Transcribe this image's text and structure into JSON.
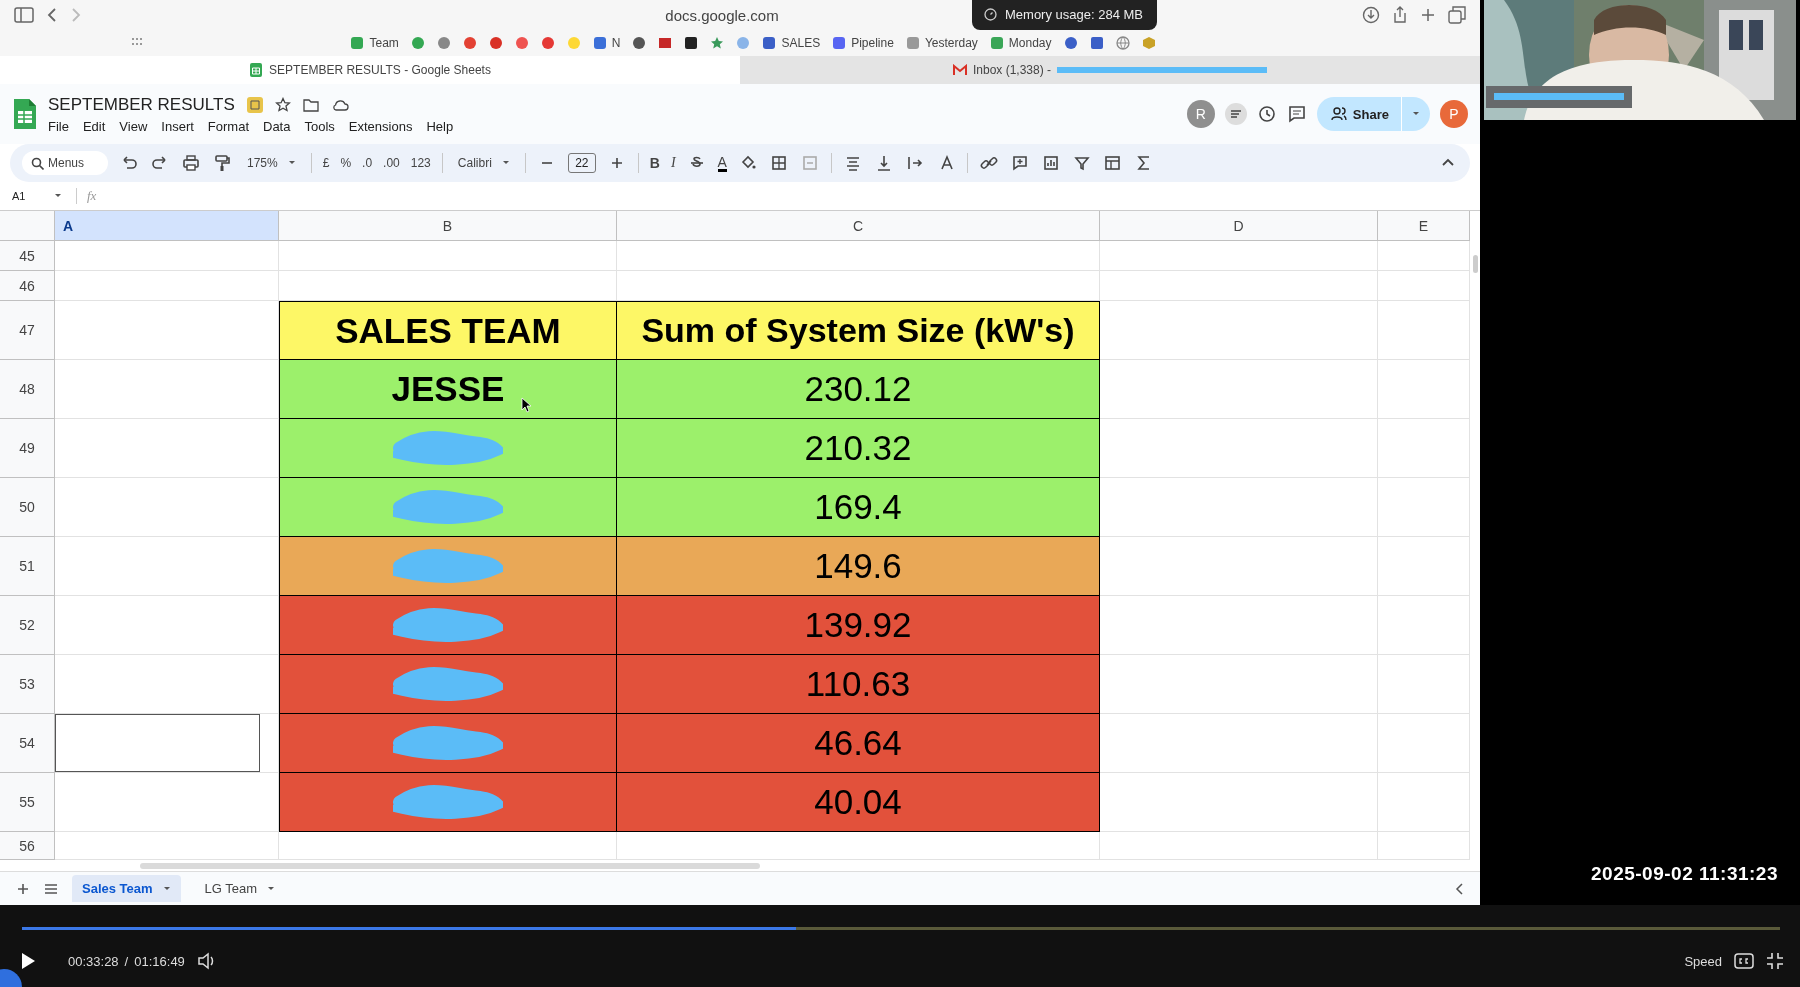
{
  "browser": {
    "url": "docs.google.com",
    "memory_tooltip": "Memory usage: 284 MB",
    "bookmarks": [
      {
        "label": "Team"
      },
      {
        "label": "N"
      },
      {
        "label": "SALES"
      },
      {
        "label": "Pipeline"
      },
      {
        "label": "Yesterday"
      },
      {
        "label": "Monday"
      }
    ],
    "tabs": [
      {
        "label": "SEPTEMBER RESULTS - Google Sheets",
        "selected": true
      },
      {
        "label": "Inbox (1,338) -",
        "selected": false
      }
    ]
  },
  "sheets": {
    "title": "SEPTEMBER RESULTS",
    "menu": [
      "File",
      "Edit",
      "View",
      "Insert",
      "Format",
      "Data",
      "Tools",
      "Extensions",
      "Help"
    ],
    "avatars": [
      {
        "initial": "R",
        "color": "#8f8f8f"
      },
      {
        "initial": "P",
        "color": "#e8693a"
      }
    ],
    "share_label": "Share",
    "toolbar": [
      {
        "kind": "search",
        "placeholder": "Menus"
      },
      {
        "kind": "dropdown",
        "label": "175%"
      },
      {
        "kind": "button",
        "label": "£"
      },
      {
        "kind": "button",
        "label": "%"
      },
      {
        "kind": "button",
        "label": ".0"
      },
      {
        "kind": "button",
        "label": ".00"
      },
      {
        "kind": "button",
        "label": "123"
      },
      {
        "kind": "dropdown",
        "label": "Calibri"
      },
      {
        "kind": "field",
        "value": "22"
      },
      {
        "kind": "bold",
        "label": "B"
      },
      {
        "kind": "italic",
        "label": "I"
      },
      {
        "kind": "color",
        "label": "A"
      }
    ],
    "cell_ref": "A1",
    "fx_label": "fx",
    "columns": [
      {
        "label": "A",
        "selected": true
      },
      {
        "label": "B",
        "selected": false
      },
      {
        "label": "C",
        "selected": false
      },
      {
        "label": "D",
        "selected": false
      },
      {
        "label": "E",
        "selected": false
      }
    ],
    "rows": [
      {
        "number": "45",
        "selected": false
      },
      {
        "number": "46",
        "selected": false
      },
      {
        "number": "47",
        "selected": false
      },
      {
        "number": "48",
        "selected": false
      },
      {
        "number": "49",
        "selected": false
      },
      {
        "number": "50",
        "selected": false
      },
      {
        "number": "51",
        "selected": false
      },
      {
        "number": "52",
        "selected": false
      },
      {
        "number": "53",
        "selected": false
      },
      {
        "number": "54",
        "selected": true
      },
      {
        "number": "55",
        "selected": false
      },
      {
        "number": "56",
        "selected": false
      }
    ],
    "table": {
      "headers": [
        "SALES TEAM",
        "Sum of System Size (kW's)"
      ],
      "rows": [
        {
          "name": "JESSE",
          "redacted": false,
          "value": "230.12",
          "color": "#9cf06b"
        },
        {
          "redacted": true,
          "value": "210.32",
          "color": "#9cf06b"
        },
        {
          "redacted": true,
          "value": "169.4",
          "color": "#9cf06b"
        },
        {
          "redacted": true,
          "value": "149.6",
          "color": "#e9a857"
        },
        {
          "redacted": true,
          "value": "139.92",
          "color": "#e2513b"
        },
        {
          "redacted": true,
          "value": "110.63",
          "color": "#e2513b"
        },
        {
          "redacted": true,
          "value": "46.64",
          "color": "#e2513b"
        },
        {
          "redacted": true,
          "value": "40.04",
          "color": "#e2513b"
        }
      ]
    },
    "sheet_tabs": [
      {
        "label": "Sales Team",
        "selected": true
      },
      {
        "label": "LG Team",
        "selected": false
      }
    ]
  },
  "player": {
    "current_time": "00:33:28",
    "separator": "/",
    "duration": "01:16:49",
    "level": 0.44,
    "speed_label": "Speed",
    "timestamp": "2025-09-02 11:31:23"
  }
}
